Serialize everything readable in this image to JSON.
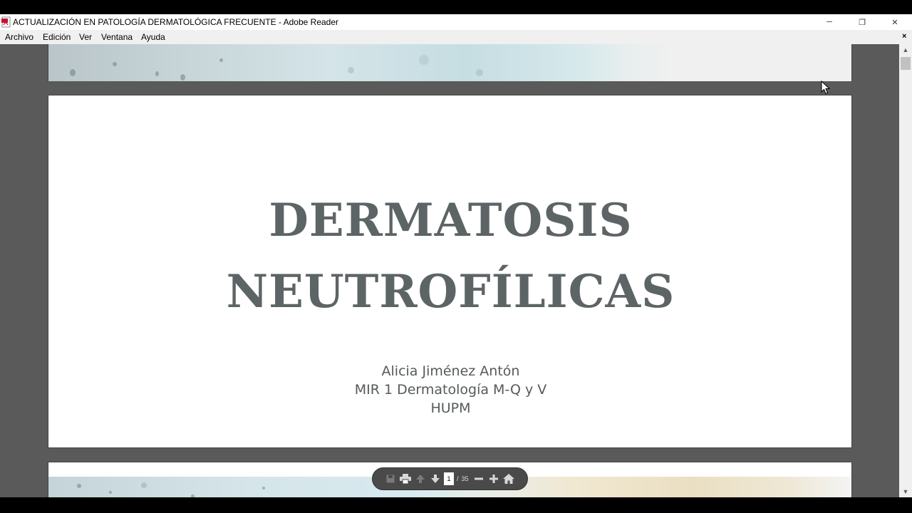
{
  "window": {
    "title": "ACTUALIZACIÓN EN PATOLOGÍA DERMATOLÓGICA FRECUENTE - Adobe Reader",
    "app_icon": "pdf-document-icon",
    "controls": {
      "minimize": "─",
      "maximize": "❐",
      "close": "✕"
    }
  },
  "menubar": {
    "items": [
      {
        "label": "Archivo"
      },
      {
        "label": "Edición"
      },
      {
        "label": "Ver"
      },
      {
        "label": "Ventana"
      },
      {
        "label": "Ayuda"
      }
    ],
    "close_glyph": "×"
  },
  "document": {
    "title_line1": "DERMATOSIS",
    "title_line2": "NEUTROFÍLICAS",
    "author_name": "Alicia Jiménez Antón",
    "author_role": "MIR 1 Dermatología M-Q y V",
    "author_org": "HUPM",
    "title_color": "#5d6465"
  },
  "toolbar": {
    "current_page": "1",
    "separator": "/",
    "total_pages": "35",
    "icons": [
      "save-icon",
      "print-icon",
      "previous-page-icon",
      "next-page-icon",
      "zoom-out-icon",
      "zoom-in-icon",
      "home-icon"
    ]
  },
  "scrollbar": {
    "up_glyph": "▲",
    "down_glyph": "▼"
  }
}
